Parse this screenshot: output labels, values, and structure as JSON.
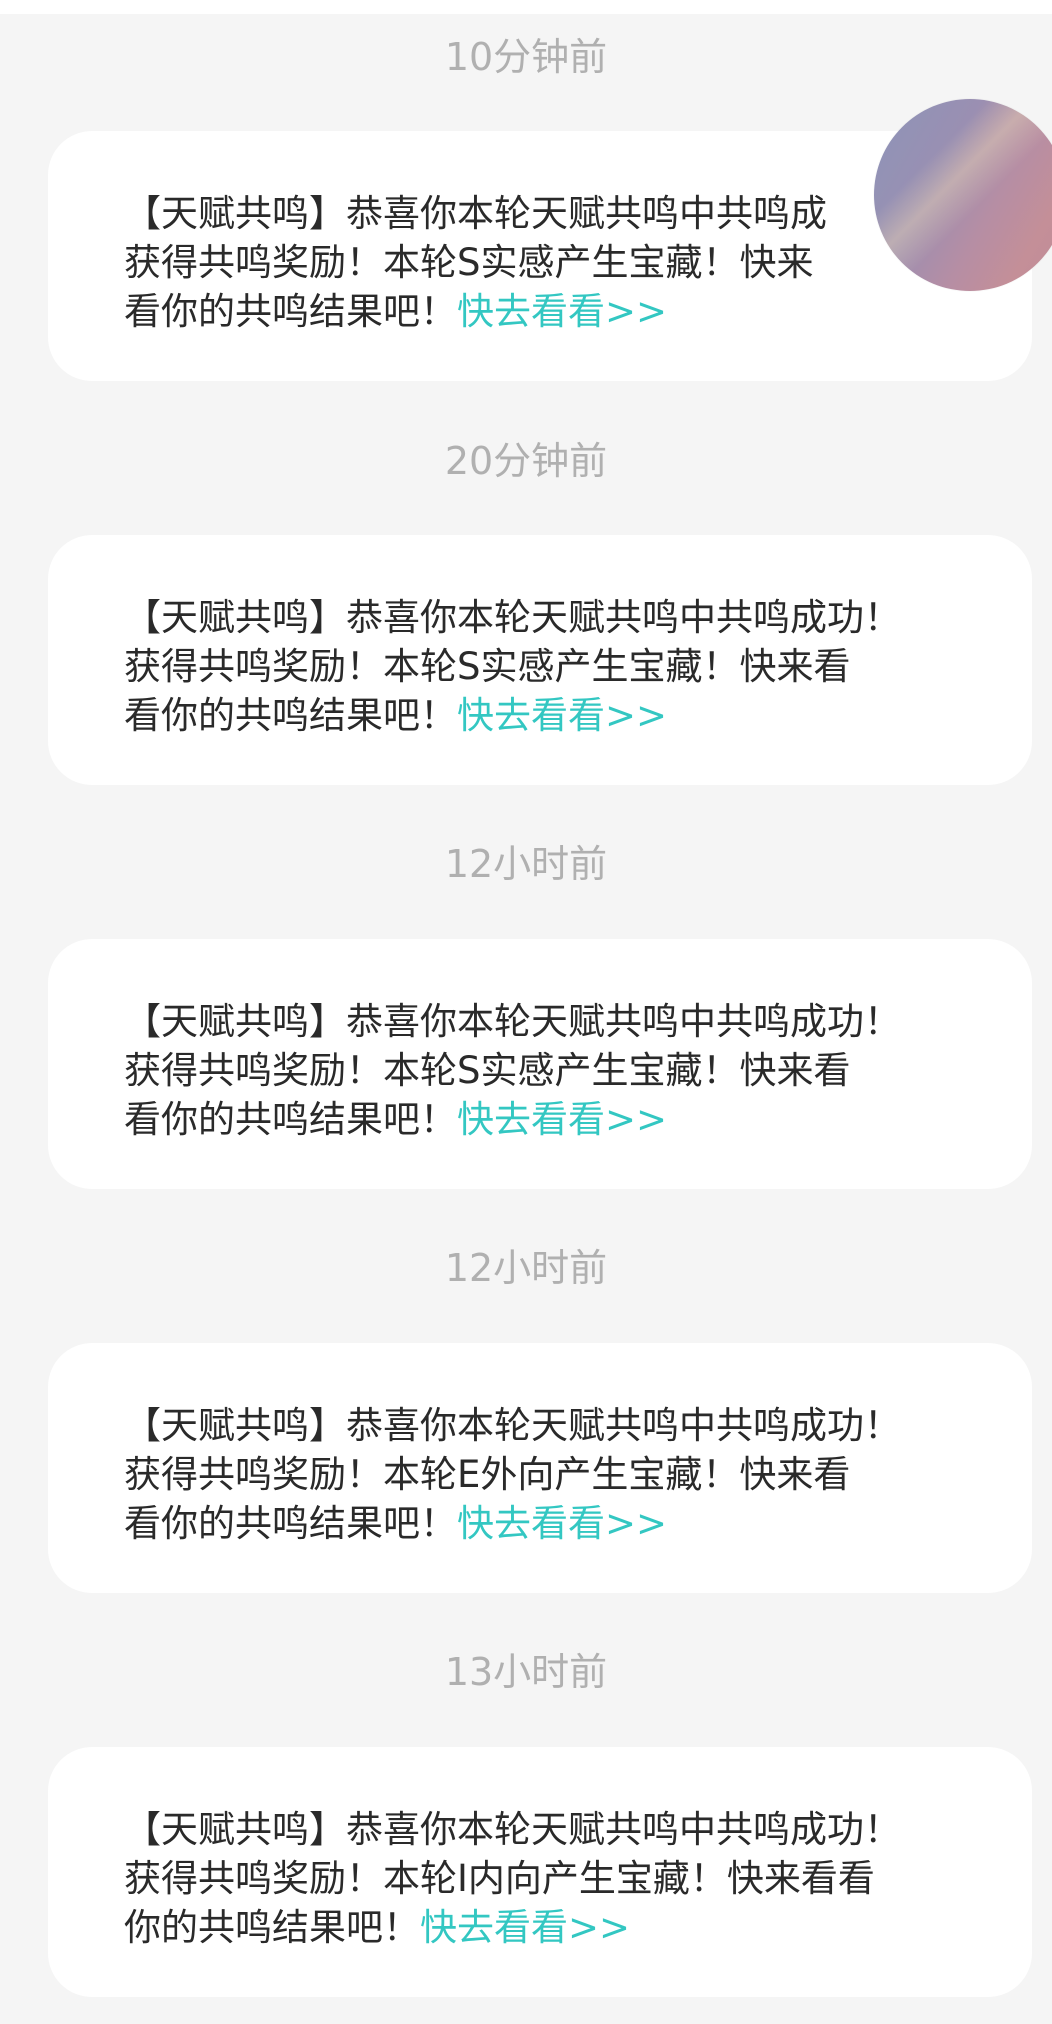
{
  "notifications": [
    {
      "time": "10分钟前",
      "line1": "【天赋共鸣】恭喜你本轮天赋共鸣中共鸣成",
      "line2": "获得共鸣奖励！本轮S实感产生宝藏！快来",
      "line3": "看你的共鸣结果吧！",
      "link": "快去看看>>"
    },
    {
      "time": "20分钟前",
      "line1": "【天赋共鸣】恭喜你本轮天赋共鸣中共鸣成功！",
      "line2": "获得共鸣奖励！本轮S实感产生宝藏！快来看",
      "line3": "看你的共鸣结果吧！",
      "link": "快去看看>>"
    },
    {
      "time": "12小时前",
      "line1": "【天赋共鸣】恭喜你本轮天赋共鸣中共鸣成功！",
      "line2": "获得共鸣奖励！本轮S实感产生宝藏！快来看",
      "line3": "看你的共鸣结果吧！",
      "link": "快去看看>>"
    },
    {
      "time": "12小时前",
      "line1": "【天赋共鸣】恭喜你本轮天赋共鸣中共鸣成功！",
      "line2": "获得共鸣奖励！本轮E外向产生宝藏！快来看",
      "line3": "看你的共鸣结果吧！",
      "link": "快去看看>>"
    },
    {
      "time": "13小时前",
      "line1": "【天赋共鸣】恭喜你本轮天赋共鸣中共鸣成功！",
      "line2": "获得共鸣奖励！本轮I内向产生宝藏！快来看看",
      "line3": "你的共鸣结果吧！",
      "link": "快去看看>>"
    }
  ],
  "colors": {
    "background": "#f5f5f5",
    "card": "#ffffff",
    "timestamp": "#b0b0b0",
    "text": "#2a2a2a",
    "link": "#33c7c2"
  },
  "avatar": {
    "icon": "user-avatar"
  }
}
